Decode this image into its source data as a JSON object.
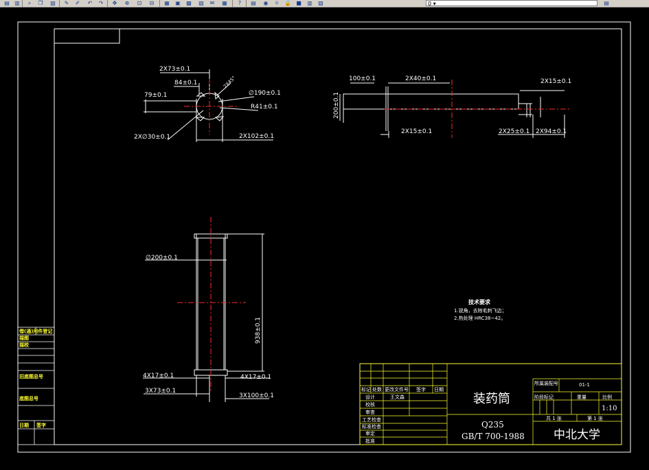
{
  "toolbar": {
    "icons": [
      "layers-icon",
      "layers2-icon",
      "zoom-icon",
      "copy-icon",
      "paste-icon",
      "brush-icon",
      "match-icon",
      "undo-icon",
      "redo-icon",
      "pan-icon",
      "zoom-realtime-icon",
      "zoom-window-icon",
      "zoom-prev-icon",
      "properties-icon",
      "designcenter-icon",
      "toolpalette-icon",
      "sheetset-icon",
      "markup-icon",
      "calc-icon",
      "help-icon",
      "layer-manager-icon",
      "bulb-icon",
      "sun-icon",
      "lock-icon",
      "color-icon",
      "layer-state-icon",
      "layer-prev-icon"
    ],
    "layer_value": "0"
  },
  "drawing": {
    "view1": {
      "dims": [
        "2X73±0.1",
        "84±0.1",
        "79±0.1",
        "2X∅30±0.1",
        "2X102±0.1",
        "∅190±0.1",
        "R41±0.1",
        "2X45°"
      ]
    },
    "view2": {
      "dims": [
        "100±0.1",
        "2X40±0.1",
        "2X15±0.1",
        "200±0.1",
        "2X15±0.1",
        "2X25±0.1",
        "2X94±0.1"
      ]
    },
    "view3": {
      "dims": [
        "∅200±0.1",
        "938±0.1",
        "4X17±0.1",
        "4X17±0.1",
        "3X73±0.1",
        "3X100±0.1"
      ]
    },
    "tech": {
      "heading": "技术要求",
      "line1": "1.锐角，去除毛刺飞边；",
      "line2": "2.热处理 HRC38~42。"
    }
  },
  "left_strip": {
    "items": [
      "借(通)用件登记",
      "描图",
      "描校",
      "旧底图总号",
      "底图总号",
      "日期",
      "签字"
    ]
  },
  "title_block": {
    "part_name": "装药筒",
    "material": "Q235",
    "standard": "GB/T 700-1988",
    "school": "中北大学",
    "drawing_no_label": "所属装配号",
    "drawing_no_value": "01-1",
    "stage_label": "阶段标记",
    "weight_label": "重量",
    "scale_label": "比例",
    "scale_value": "1:10",
    "sheets_total": "共 1 张",
    "sheet_no": "第 1 张",
    "row_labels": [
      "标记",
      "处数",
      "更改文件号",
      "签字",
      "日期"
    ],
    "design_label": "设计",
    "designer": "王文森",
    "check_label": "校核",
    "review_label": "审查",
    "process_label": "工艺检查",
    "std_label": "标准检查",
    "approve_label": "审定",
    "ratify_label": "批准"
  }
}
